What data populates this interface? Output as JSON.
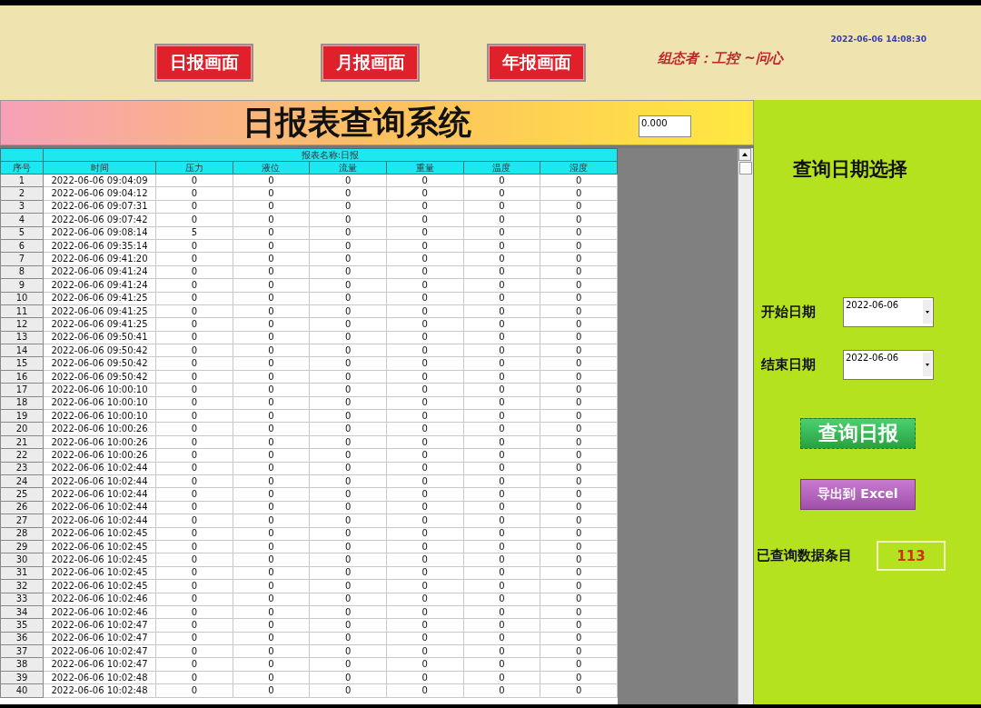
{
  "header": {
    "nav_buttons": [
      {
        "label": "日报画面"
      },
      {
        "label": "月报画面"
      },
      {
        "label": "年报画面"
      }
    ],
    "author": "组态者：工控 ~问心",
    "datetime": "2022-06-06 14:08:30"
  },
  "title_bar": {
    "title": "日报表查询系统",
    "value_field": "0.000"
  },
  "table": {
    "caption": "报表名称:日报",
    "columns": [
      "序号",
      "时间",
      "压力",
      "液位",
      "流量",
      "重量",
      "温度",
      "湿度"
    ],
    "rows": [
      [
        "1",
        "2022-06-06 09:04:09",
        "0",
        "0",
        "0",
        "0",
        "0",
        "0"
      ],
      [
        "2",
        "2022-06-06 09:04:12",
        "0",
        "0",
        "0",
        "0",
        "0",
        "0"
      ],
      [
        "3",
        "2022-06-06 09:07:31",
        "0",
        "0",
        "0",
        "0",
        "0",
        "0"
      ],
      [
        "4",
        "2022-06-06 09:07:42",
        "0",
        "0",
        "0",
        "0",
        "0",
        "0"
      ],
      [
        "5",
        "2022-06-06 09:08:14",
        "5",
        "0",
        "0",
        "0",
        "0",
        "0"
      ],
      [
        "6",
        "2022-06-06 09:35:14",
        "0",
        "0",
        "0",
        "0",
        "0",
        "0"
      ],
      [
        "7",
        "2022-06-06 09:41:20",
        "0",
        "0",
        "0",
        "0",
        "0",
        "0"
      ],
      [
        "8",
        "2022-06-06 09:41:24",
        "0",
        "0",
        "0",
        "0",
        "0",
        "0"
      ],
      [
        "9",
        "2022-06-06 09:41:24",
        "0",
        "0",
        "0",
        "0",
        "0",
        "0"
      ],
      [
        "10",
        "2022-06-06 09:41:25",
        "0",
        "0",
        "0",
        "0",
        "0",
        "0"
      ],
      [
        "11",
        "2022-06-06 09:41:25",
        "0",
        "0",
        "0",
        "0",
        "0",
        "0"
      ],
      [
        "12",
        "2022-06-06 09:41:25",
        "0",
        "0",
        "0",
        "0",
        "0",
        "0"
      ],
      [
        "13",
        "2022-06-06 09:50:41",
        "0",
        "0",
        "0",
        "0",
        "0",
        "0"
      ],
      [
        "14",
        "2022-06-06 09:50:42",
        "0",
        "0",
        "0",
        "0",
        "0",
        "0"
      ],
      [
        "15",
        "2022-06-06 09:50:42",
        "0",
        "0",
        "0",
        "0",
        "0",
        "0"
      ],
      [
        "16",
        "2022-06-06 09:50:42",
        "0",
        "0",
        "0",
        "0",
        "0",
        "0"
      ],
      [
        "17",
        "2022-06-06 10:00:10",
        "0",
        "0",
        "0",
        "0",
        "0",
        "0"
      ],
      [
        "18",
        "2022-06-06 10:00:10",
        "0",
        "0",
        "0",
        "0",
        "0",
        "0"
      ],
      [
        "19",
        "2022-06-06 10:00:10",
        "0",
        "0",
        "0",
        "0",
        "0",
        "0"
      ],
      [
        "20",
        "2022-06-06 10:00:26",
        "0",
        "0",
        "0",
        "0",
        "0",
        "0"
      ],
      [
        "21",
        "2022-06-06 10:00:26",
        "0",
        "0",
        "0",
        "0",
        "0",
        "0"
      ],
      [
        "22",
        "2022-06-06 10:00:26",
        "0",
        "0",
        "0",
        "0",
        "0",
        "0"
      ],
      [
        "23",
        "2022-06-06 10:02:44",
        "0",
        "0",
        "0",
        "0",
        "0",
        "0"
      ],
      [
        "24",
        "2022-06-06 10:02:44",
        "0",
        "0",
        "0",
        "0",
        "0",
        "0"
      ],
      [
        "25",
        "2022-06-06 10:02:44",
        "0",
        "0",
        "0",
        "0",
        "0",
        "0"
      ],
      [
        "26",
        "2022-06-06 10:02:44",
        "0",
        "0",
        "0",
        "0",
        "0",
        "0"
      ],
      [
        "27",
        "2022-06-06 10:02:44",
        "0",
        "0",
        "0",
        "0",
        "0",
        "0"
      ],
      [
        "28",
        "2022-06-06 10:02:45",
        "0",
        "0",
        "0",
        "0",
        "0",
        "0"
      ],
      [
        "29",
        "2022-06-06 10:02:45",
        "0",
        "0",
        "0",
        "0",
        "0",
        "0"
      ],
      [
        "30",
        "2022-06-06 10:02:45",
        "0",
        "0",
        "0",
        "0",
        "0",
        "0"
      ],
      [
        "31",
        "2022-06-06 10:02:45",
        "0",
        "0",
        "0",
        "0",
        "0",
        "0"
      ],
      [
        "32",
        "2022-06-06 10:02:45",
        "0",
        "0",
        "0",
        "0",
        "0",
        "0"
      ],
      [
        "33",
        "2022-06-06 10:02:46",
        "0",
        "0",
        "0",
        "0",
        "0",
        "0"
      ],
      [
        "34",
        "2022-06-06 10:02:46",
        "0",
        "0",
        "0",
        "0",
        "0",
        "0"
      ],
      [
        "35",
        "2022-06-06 10:02:47",
        "0",
        "0",
        "0",
        "0",
        "0",
        "0"
      ],
      [
        "36",
        "2022-06-06 10:02:47",
        "0",
        "0",
        "0",
        "0",
        "0",
        "0"
      ],
      [
        "37",
        "2022-06-06 10:02:47",
        "0",
        "0",
        "0",
        "0",
        "0",
        "0"
      ],
      [
        "38",
        "2022-06-06 10:02:47",
        "0",
        "0",
        "0",
        "0",
        "0",
        "0"
      ],
      [
        "39",
        "2022-06-06 10:02:48",
        "0",
        "0",
        "0",
        "0",
        "0",
        "0"
      ],
      [
        "40",
        "2022-06-06 10:02:48",
        "0",
        "0",
        "0",
        "0",
        "0",
        "0"
      ]
    ]
  },
  "side_panel": {
    "heading": "查询日期选择",
    "start_date": {
      "label": "开始日期",
      "value": "2022-06-06"
    },
    "end_date": {
      "label": "结束日期",
      "value": "2022-06-06"
    },
    "query_button": "查询日报",
    "export_button": "导出到 Excel",
    "count": {
      "label": "已查询数据条目",
      "value": "113"
    }
  }
}
